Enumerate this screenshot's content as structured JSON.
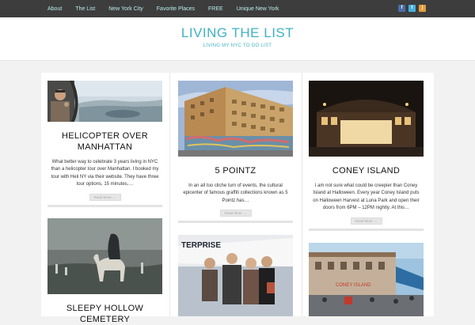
{
  "nav": {
    "items": [
      {
        "label": "About"
      },
      {
        "label": "The List"
      },
      {
        "label": "New York City"
      },
      {
        "label": "Favorite Places"
      },
      {
        "label": "FREE"
      },
      {
        "label": "Unique New York"
      }
    ],
    "social": [
      {
        "icon": "facebook-icon",
        "glyph": "f",
        "color": "#4a6ea8"
      },
      {
        "icon": "twitter-icon",
        "glyph": "t",
        "color": "#47b1e0"
      },
      {
        "icon": "rss-icon",
        "glyph": ")",
        "color": "#e59a3b"
      }
    ]
  },
  "header": {
    "title": "LIVING THE LIST",
    "tagline": "LIVING MY NYC TO DO LIST",
    "accent": "#3fb1c2"
  },
  "posts": [
    {
      "title": "HELICOPTER OVER MANHATTAN",
      "excerpt": "What better way to celebrate 3 years living in NYC than a helicopter tour over Manhattan. I booked my tour with Heli NY via their website. They have three tour options, 15 minutes,…",
      "read_more": "Read More →"
    },
    {
      "title": "5 POINTZ",
      "excerpt": "In an all too cliche turn of events, the cultural epicenter of famous graffiti collections known as 5 Pointz has…",
      "read_more": "Read More →"
    },
    {
      "title": "CONEY ISLAND",
      "excerpt": "I am not sure what could be creepier than Coney Island at Halloween. Every year Coney Island puts on Halloween Harvest at Luna Park and open their doors from 6PM – 12PM nightly. At this…",
      "read_more": "Read More →"
    },
    {
      "title": "SLEEPY HOLLOW CEMETERY"
    },
    {
      "image_text": "TERPRISE"
    },
    {
      "image_text": "CONEY ISLAND"
    }
  ]
}
